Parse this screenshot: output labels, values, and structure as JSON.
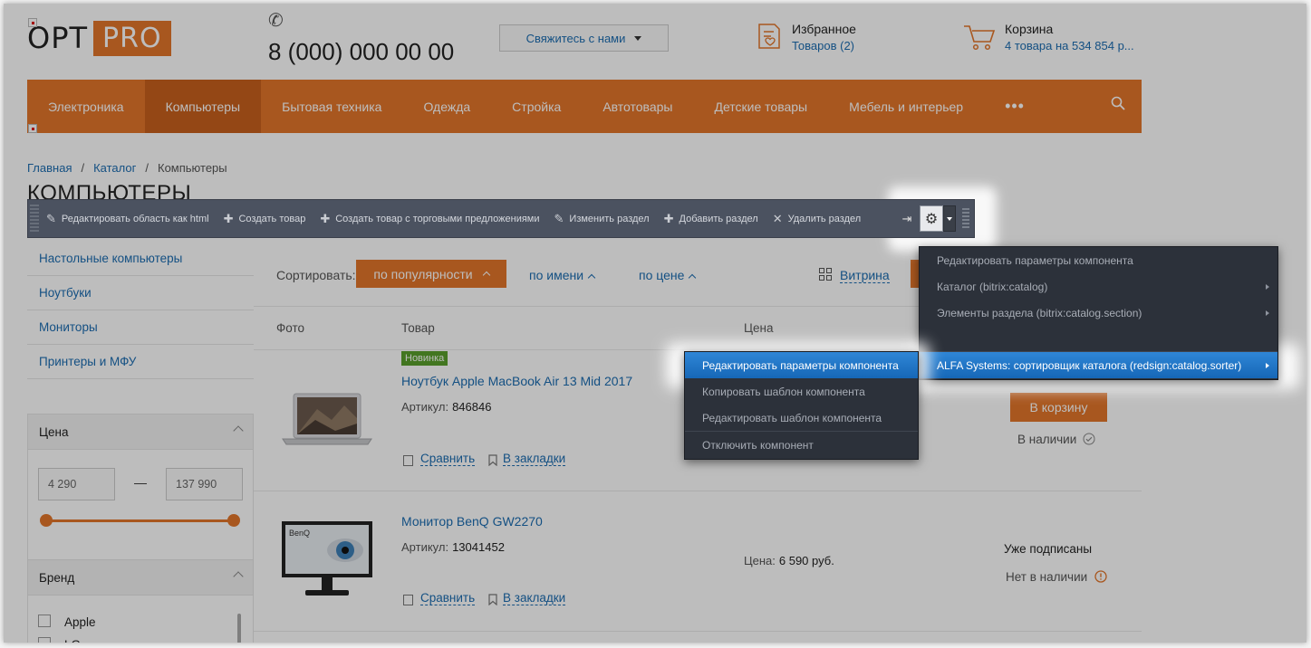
{
  "header": {
    "logo_opt": "OPT",
    "logo_pro": "PRO",
    "phone": "8 (000) 000 00 00",
    "contact_label": "Свяжитесь с нами",
    "favorites_title": "Избранное",
    "favorites_sub": "Товаров (2)",
    "cart_title": "Корзина",
    "cart_sub": "4 товара на 534 854 р..."
  },
  "nav": {
    "items": [
      "Электроника",
      "Компьютеры",
      "Бытовая техника",
      "Одежда",
      "Стройка",
      "Автотовары",
      "Детские товары",
      "Мебель и интерьер"
    ],
    "active": "Компьютеры",
    "more": "•••"
  },
  "breadcrumb": {
    "items": [
      "Главная",
      "Каталог",
      "Компьютеры"
    ],
    "sep": "/"
  },
  "page_title": "КОМПЬЮТЕРЫ",
  "toolbar": {
    "items": [
      "Редактировать область как html",
      "Создать товар",
      "Создать товар с торговыми предложениями",
      "Изменить раздел",
      "Добавить раздел",
      "Удалить раздел"
    ]
  },
  "sidebar": {
    "links": [
      "Настольные компьютеры",
      "Ноутбуки",
      "Мониторы",
      "Принтеры и МФУ"
    ],
    "price_title": "Цена",
    "price_min": "4 290",
    "price_dash": "—",
    "price_max": "137 990",
    "brand_title": "Бренд",
    "brands": [
      "Apple",
      "LG"
    ]
  },
  "sort": {
    "label": "Сортировать:",
    "active": "по популярности",
    "by_name": "по имени",
    "by_price": "по цене",
    "view": "Витрина"
  },
  "table": {
    "col_photo": "Фото",
    "col_product": "Товар",
    "col_price": "Цена"
  },
  "products": [
    {
      "badge": "Новинка",
      "name": "Ноутбук Apple MacBook Air 13 Mid 2017",
      "sku_label": "Артикул:",
      "sku": "846846",
      "compare": "Сравнить",
      "bookmark": "В закладки",
      "button": "В корзину",
      "stock": "В наличии"
    },
    {
      "name": "Монитор BenQ GW2270",
      "sku_label": "Артикул:",
      "sku": "13041452",
      "compare": "Сравнить",
      "bookmark": "В закладки",
      "price_label": "Цена:",
      "price": "6 590 руб.",
      "subscribed": "Уже подписаны",
      "stock": "Нет в наличии",
      "monitor_brand": "BenQ"
    }
  ],
  "menu_main": {
    "items": [
      "Редактировать параметры компонента",
      "Каталог (bitrix:catalog)",
      "Элементы раздела (bitrix:catalog.section)",
      "ALFA Systems: сортировщик каталога (redsign:catalog.sorter)"
    ]
  },
  "menu_sub": {
    "items": [
      "Редактировать параметры компонента",
      "Копировать шаблон компонента",
      "Редактировать шаблон компонента",
      "Отключить компонент"
    ]
  },
  "colors": {
    "accent": "#e3762b",
    "link": "#1c6db1",
    "menu_highlight": "#1f77c9"
  }
}
